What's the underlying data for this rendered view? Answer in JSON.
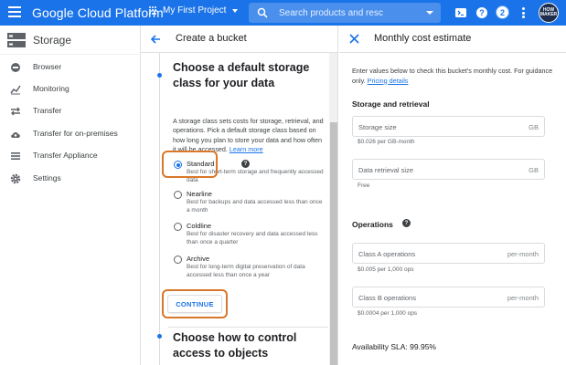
{
  "topbar": {
    "title": "Google Cloud Platform",
    "project": "My First Project",
    "search_placeholder": "Search products and resc",
    "notification_count": "2",
    "avatar_text": "HOW MAKER",
    "color": "#1a73e8"
  },
  "leftnav": {
    "title": "Storage",
    "items": [
      {
        "label": "Browser",
        "icon": "storage-bucket-icon"
      },
      {
        "label": "Monitoring",
        "icon": "chart-icon"
      },
      {
        "label": "Transfer",
        "icon": "transfer-arrows-icon"
      },
      {
        "label": "Transfer for on-premises",
        "icon": "cloud-upload-icon"
      },
      {
        "label": "Transfer Appliance",
        "icon": "list-icon"
      },
      {
        "label": "Settings",
        "icon": "gear-icon"
      }
    ]
  },
  "middle": {
    "header_title": "Create a bucket",
    "section_title_line1": "Choose a default storage",
    "section_title_line2": "class for your data",
    "description": "A storage class sets costs for storage, retrieval, and operations. Pick a default storage class based on how long you plan to store your data and how often it will be accessed.",
    "learn_more": "Learn more",
    "options": [
      {
        "label": "Standard",
        "desc": "Best for short-term storage and frequently accessed data",
        "selected": true
      },
      {
        "label": "Nearline",
        "desc": "Best for backups and data accessed less than once a month",
        "selected": false
      },
      {
        "label": "Coldline",
        "desc": "Best for disaster recovery and data accessed less than once a quarter",
        "selected": false
      },
      {
        "label": "Archive",
        "desc": "Best for long-term digital preservation of data accessed less than once a year",
        "selected": false
      }
    ],
    "continue_label": "CONTINUE",
    "next_title_line1": "Choose how to control",
    "next_title_line2": "access to objects",
    "highlight_color": "#d9772a"
  },
  "right": {
    "header_title": "Monthly cost estimate",
    "intro": "Enter values below to check this bucket's monthly cost. For guidance only.",
    "pricing_link": "Pricing details",
    "storage_heading": "Storage and retrieval",
    "storage_size": {
      "placeholder": "Storage size",
      "suffix": "GB",
      "help": "$0.026 per GB-month"
    },
    "retrieval": {
      "placeholder": "Data retrieval size",
      "suffix": "GB",
      "help": "Free"
    },
    "operations_heading": "Operations",
    "class_a": {
      "placeholder": "Class A operations",
      "suffix": "per-month",
      "help": "$0.005 per 1,000 ops"
    },
    "class_b": {
      "placeholder": "Class B operations",
      "suffix": "per-month",
      "help": "$0.0004 per 1,000 ops"
    },
    "sla": "Availability SLA: 99.95%"
  }
}
